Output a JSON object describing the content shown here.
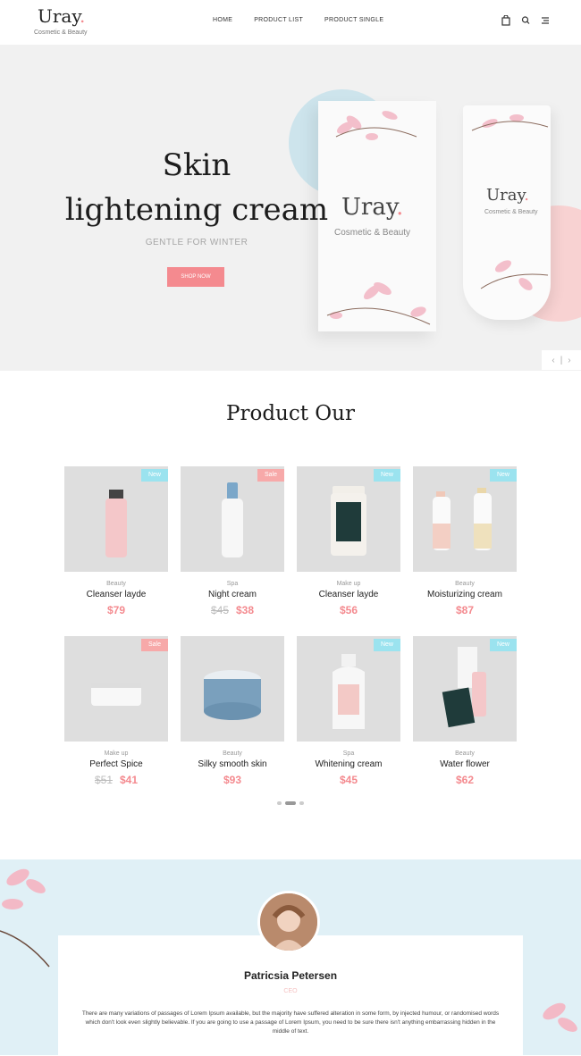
{
  "header": {
    "logo": "Uray",
    "logo_dot": ".",
    "tagline": "Cosmetic & Beauty",
    "nav": [
      "HOME",
      "PRODUCT LIST",
      "PRODUCT SINGLE"
    ],
    "icons": [
      "bag-icon",
      "search-icon",
      "menu-icon"
    ]
  },
  "hero": {
    "title_line1": "Skin",
    "title_line2": "lightening cream",
    "subtitle": "GENTLE FOR WINTER",
    "button": "SHOP NOW",
    "box_brand": "Uray",
    "box_sub": "Cosmetic & Beauty",
    "tube_brand": "Uray",
    "tube_sub": "Cosmetic & Beauty",
    "slider_prev": "‹",
    "slider_sep": "|",
    "slider_next": "›"
  },
  "products": {
    "title": "Product Our",
    "items": [
      {
        "category": "Beauty",
        "name": "Cleanser layde",
        "price": "$79",
        "old_price": "",
        "badge": "New",
        "badge_type": "new",
        "image": "tube-pink"
      },
      {
        "category": "Spa",
        "name": "Night cream",
        "price": "$38",
        "old_price": "$45",
        "badge": "Sale",
        "badge_type": "sale",
        "image": "bottle-blue"
      },
      {
        "category": "Make up",
        "name": "Cleanser layde",
        "price": "$56",
        "old_price": "",
        "badge": "New",
        "badge_type": "new",
        "image": "jar-green"
      },
      {
        "category": "Beauty",
        "name": "Moisturizing cream",
        "price": "$87",
        "old_price": "",
        "badge": "New",
        "badge_type": "new",
        "image": "two-bottles"
      },
      {
        "category": "Make up",
        "name": "Perfect Spice",
        "price": "$41",
        "old_price": "$51",
        "badge": "Sale",
        "badge_type": "sale",
        "image": "tin-white"
      },
      {
        "category": "Beauty",
        "name": "Silky smooth skin",
        "price": "$93",
        "old_price": "",
        "badge": "",
        "badge_type": "",
        "image": "jar-blue"
      },
      {
        "category": "Spa",
        "name": "Whitening cream",
        "price": "$45",
        "old_price": "",
        "badge": "New",
        "badge_type": "new",
        "image": "bottle-pink"
      },
      {
        "category": "Beauty",
        "name": "Water flower",
        "price": "$62",
        "old_price": "",
        "badge": "New",
        "badge_type": "new",
        "image": "kit"
      }
    ]
  },
  "testimonial": {
    "name": "Patricsia Petersen",
    "role": "CEO",
    "text": "There are many variations of passages of Lorem Ipsum available, but the majority have suffered alteration in some form, by injected humour, or randomised words which don't look even slightly believable. If you are going to use a passage of Lorem Ipsum, you need to be sure there isn't anything embarrassing hidden in the middle of text."
  },
  "colors": {
    "accent": "#f48a8f",
    "new_badge": "#9be3ef",
    "sale_badge": "#f7a9a9",
    "testimonial_bg": "#e0f0f6"
  }
}
